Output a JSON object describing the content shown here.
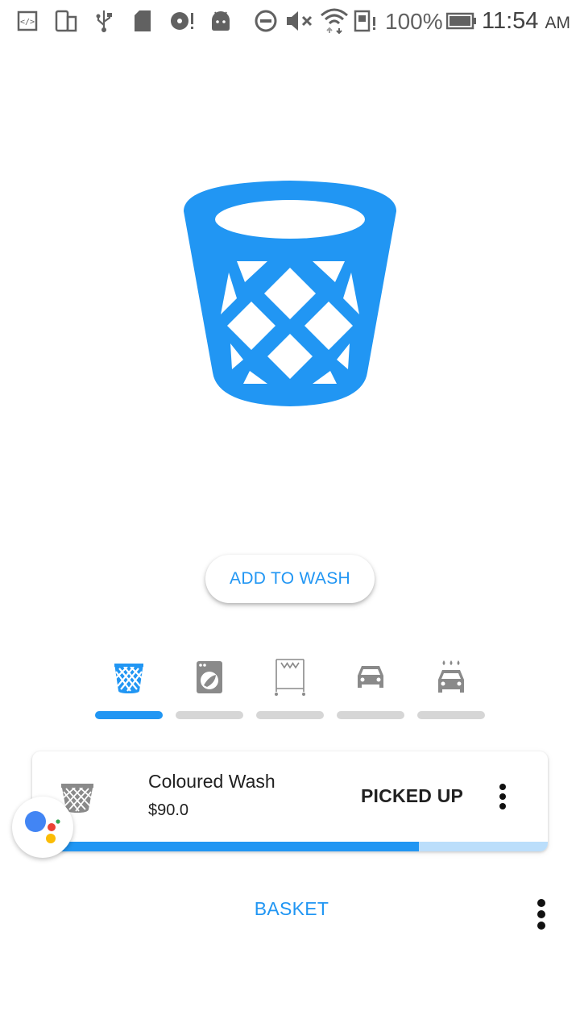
{
  "status_bar": {
    "battery_text": "100%",
    "time": "11:54",
    "ampm": "AM",
    "icons": [
      "code-icon",
      "phone-rotate-icon",
      "usb-icon",
      "sd-card-icon",
      "disk-alert-icon",
      "android-icon",
      "do-not-disturb-icon",
      "mute-icon",
      "wifi-icon",
      "sim-alert-icon",
      "battery-icon"
    ]
  },
  "hero": {
    "icon": "laundry-basket-icon",
    "color": "#2196F3"
  },
  "actions": {
    "add_to_wash_label": "ADD TO WASH"
  },
  "steps": [
    {
      "icon": "basket-icon",
      "active": true
    },
    {
      "icon": "washing-machine-icon",
      "active": false
    },
    {
      "icon": "clothes-rack-icon",
      "active": false
    },
    {
      "icon": "delivery-car-icon",
      "active": false
    },
    {
      "icon": "car-wash-icon",
      "active": false
    }
  ],
  "order": {
    "icon": "basket-icon",
    "title": "Coloured Wash",
    "price": "$90.0",
    "status": "PICKED UP",
    "progress": 0.75
  },
  "bottom": {
    "tab_label": "BASKET"
  },
  "colors": {
    "accent": "#2196F3",
    "inactive": "#D6D6D6",
    "icon_gray": "#8A8A8A"
  }
}
